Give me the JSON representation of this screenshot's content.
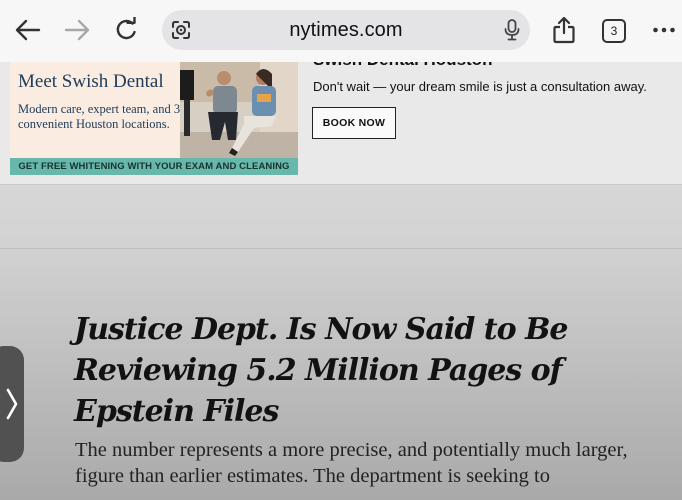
{
  "browser": {
    "url": "nytimes.com",
    "tab_count": "3"
  },
  "ad": {
    "creative_headline": "Meet Swish Dental",
    "creative_sub": "Modern care, expert team, and 3 convenient Houston locations.",
    "creative_strip": "GET FREE WHITENING WITH YOUR EXAM AND CLEANING",
    "advertiser": "Swish Dental Houston",
    "description": "Don't wait — your dream smile is just a consultation away.",
    "cta_label": "BOOK NOW"
  },
  "article": {
    "headline": "Justice Dept. Is Now Said to Be Reviewing 5.2 Million Pages of Epstein Files",
    "summary": "The number represents a more precise, and potentially much larger, figure than earlier estimates. The department is seeking to"
  },
  "icons": {
    "back": "back-arrow-icon",
    "forward": "forward-arrow-icon",
    "reload": "reload-icon",
    "lens": "camera-lens-icon",
    "mic": "microphone-icon",
    "share": "share-icon",
    "tabs": "tabs-icon",
    "more": "more-dots-icon",
    "side": "chevron-right-icon"
  }
}
